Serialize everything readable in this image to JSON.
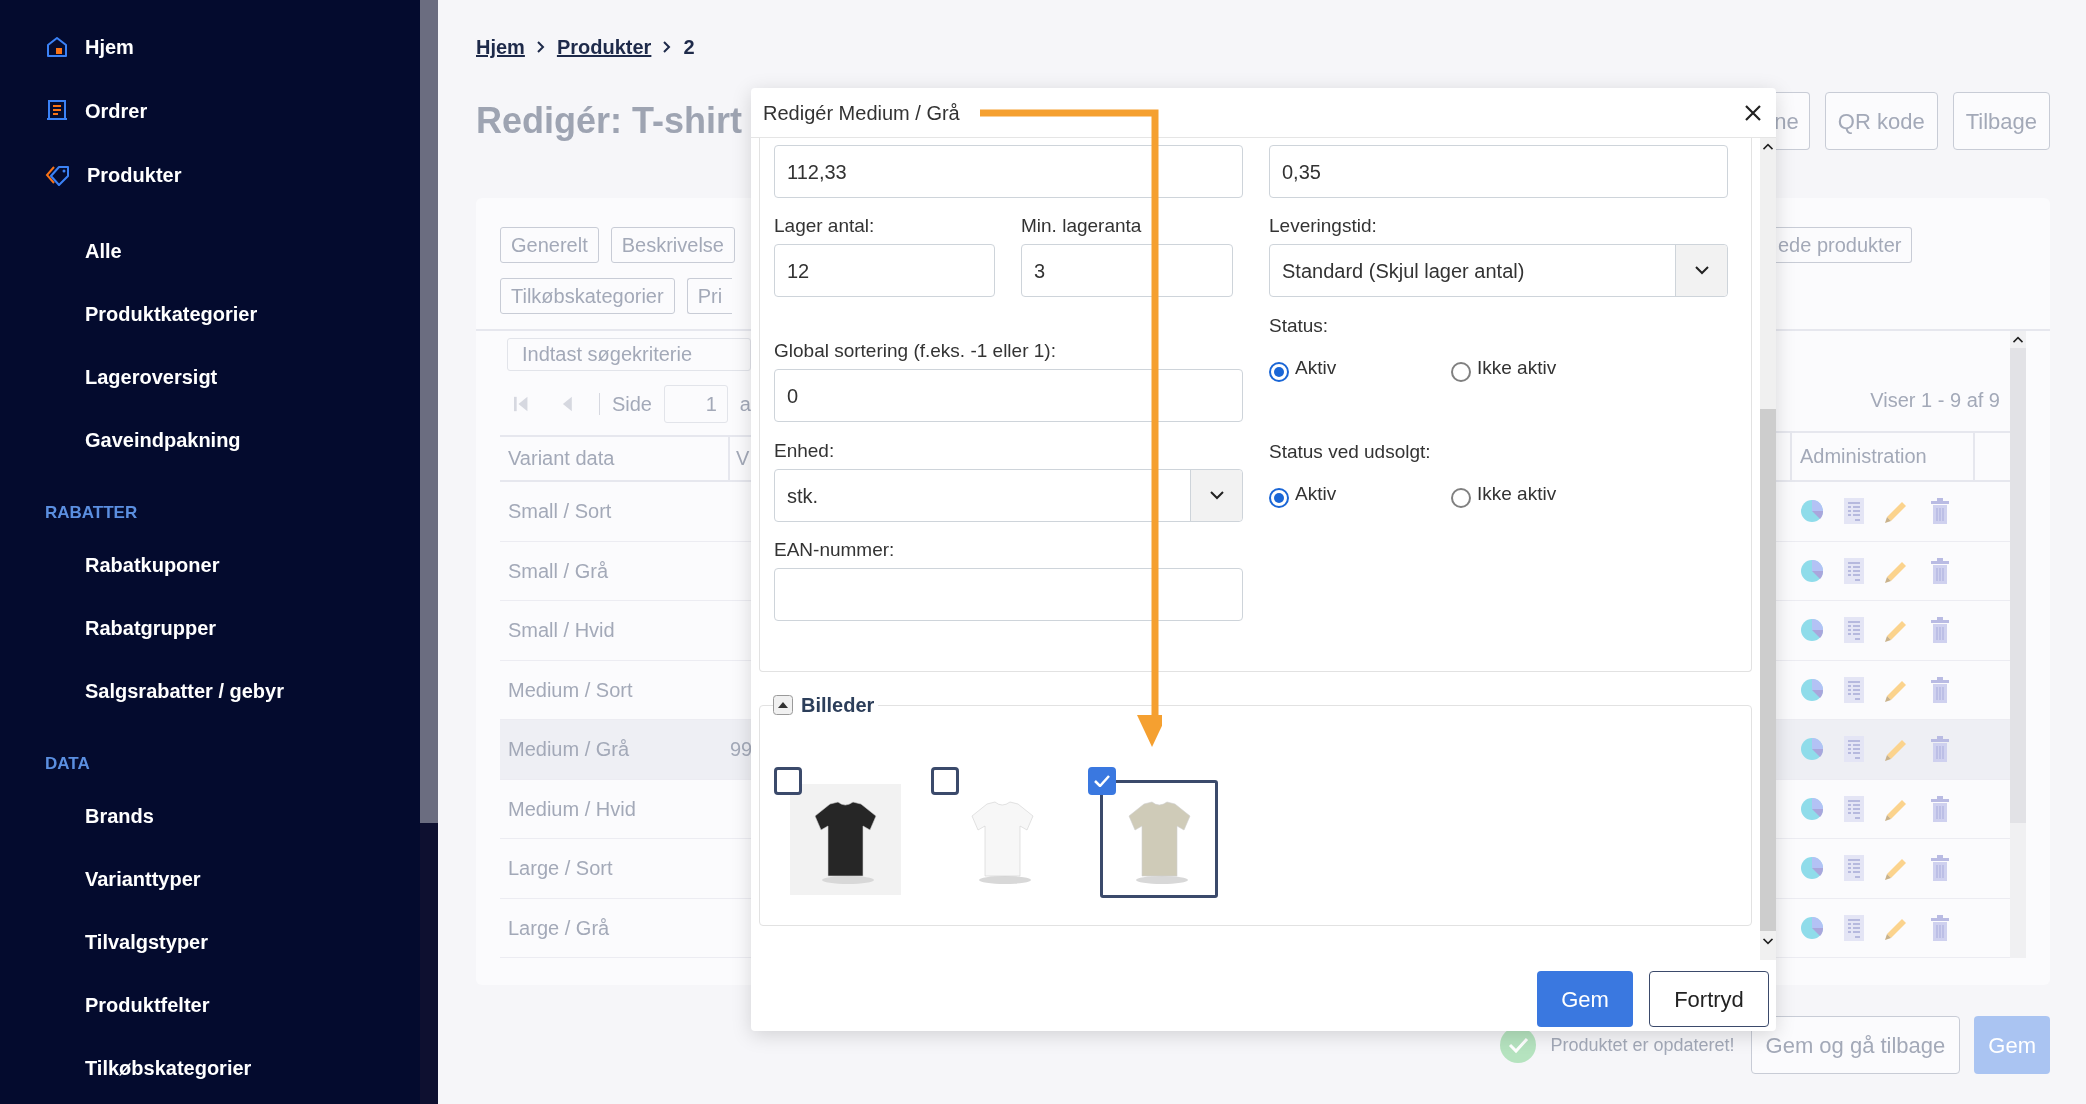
{
  "sidebar": {
    "items": [
      {
        "kind": "nav",
        "label": "Hjem"
      },
      {
        "kind": "nav",
        "label": "Ordrer"
      },
      {
        "kind": "nav",
        "label": "Produkter"
      },
      {
        "kind": "subnav",
        "label": "Alle"
      },
      {
        "kind": "subnav",
        "label": "Produktkategorier"
      },
      {
        "kind": "subnav",
        "label": "Lageroversigt"
      },
      {
        "kind": "subnav",
        "label": "Gaveindpakning"
      },
      {
        "kind": "section",
        "label": "RABATTER"
      },
      {
        "kind": "subnav",
        "label": "Rabatkuponer"
      },
      {
        "kind": "subnav",
        "label": "Rabatgrupper"
      },
      {
        "kind": "subnav",
        "label": "Salgsrabatter / gebyr"
      },
      {
        "kind": "section",
        "label": "DATA"
      },
      {
        "kind": "subnav",
        "label": "Brands"
      },
      {
        "kind": "subnav",
        "label": "Varianttyper"
      },
      {
        "kind": "subnav",
        "label": "Tilvalgstyper"
      },
      {
        "kind": "subnav",
        "label": "Produktfelter"
      },
      {
        "kind": "subnav",
        "label": "Tilkøbskategorier"
      }
    ]
  },
  "breadcrumb": [
    {
      "label": "Hjem",
      "kind": "link"
    },
    {
      "label": "Produkter",
      "kind": "link"
    },
    {
      "label": "2",
      "kind": "current"
    }
  ],
  "page": {
    "title": "Redigér: T-shirt",
    "buttons": [
      "ne",
      "QR kode",
      "Tilbage"
    ]
  },
  "tabs": {
    "left": [
      "Generelt",
      "Beskrivelse",
      "Tilkøbskategorier",
      "Pri"
    ],
    "right": [
      "ede produkter"
    ]
  },
  "search": {
    "placeholder": "Indtast søgekriterie"
  },
  "pager": {
    "label": "Side",
    "page": "1",
    "after": "a",
    "summary": "Viser 1 - 9 af 9"
  },
  "table": {
    "columns": [
      "Variant data",
      "V",
      "Administration"
    ],
    "rows": [
      {
        "variant": "Small / Sort",
        "selected": false
      },
      {
        "variant": "Small / Grå",
        "selected": false
      },
      {
        "variant": "Small / Hvid",
        "selected": false
      },
      {
        "variant": "Medium / Sort",
        "selected": false
      },
      {
        "variant": "Medium / Grå",
        "column_2": "99",
        "selected": true
      },
      {
        "variant": "Medium / Hvid",
        "selected": false
      },
      {
        "variant": "Large / Sort",
        "selected": false
      },
      {
        "variant": "Large / Grå",
        "selected": false
      }
    ]
  },
  "status": {
    "message": "Produktet er opdateret!"
  },
  "footer_buttons": [
    {
      "label": "Gem og gå tilbage",
      "kind": "secondary"
    },
    {
      "label": "Gem",
      "kind": "primary"
    }
  ],
  "dialog": {
    "title": "Redigér Medium / Grå",
    "top_left": {
      "value": "112,33"
    },
    "top_right": {
      "value": "0,35"
    },
    "stock": {
      "label": "Lager antal:",
      "value": "12"
    },
    "min_stock": {
      "label": "Min. lageranta",
      "value": "3"
    },
    "delivery": {
      "label": "Leveringstid:",
      "value": "Standard (Skjul lager antal)"
    },
    "status": {
      "label": "Status:",
      "options": [
        {
          "label": "Aktiv",
          "selected": true
        },
        {
          "label": "Ikke aktiv",
          "selected": false
        }
      ]
    },
    "sorting": {
      "label": "Global sortering (f.eks. -1 eller 1):",
      "value": "0"
    },
    "unit": {
      "label": "Enhed:",
      "value": "stk."
    },
    "status_sold_out": {
      "label": "Status ved udsolgt:",
      "options": [
        {
          "label": "Aktiv",
          "selected": true
        },
        {
          "label": "Ikke aktiv",
          "selected": false
        }
      ]
    },
    "ean": {
      "label": "EAN-nummer:"
    },
    "images": {
      "legend": "Billeder",
      "expanded": true,
      "items": [
        {
          "kind": "picture",
          "checked": false
        },
        {
          "kind": "picture",
          "checked": false
        },
        {
          "kind": "picture",
          "checked": true
        }
      ]
    },
    "buttons": [
      {
        "label": "Gem",
        "kind": "primary"
      },
      {
        "label": "Fortryd",
        "kind": "secondary"
      }
    ]
  }
}
